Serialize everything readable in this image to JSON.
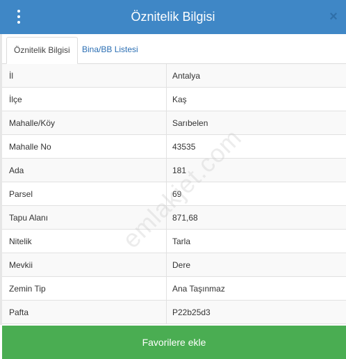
{
  "header": {
    "title": "Öznitelik Bilgisi",
    "menu_icon": "vertical-dots-icon",
    "close_icon": "close-icon",
    "close_glyph": "×"
  },
  "tabs": [
    {
      "label": "Öznitelik Bilgisi",
      "active": true
    },
    {
      "label": "Bina/BB Listesi",
      "active": false
    }
  ],
  "rows": [
    {
      "key": "İl",
      "value": "Antalya"
    },
    {
      "key": "İlçe",
      "value": "Kaş"
    },
    {
      "key": "Mahalle/Köy",
      "value": "Sarıbelen"
    },
    {
      "key": "Mahalle No",
      "value": "43535"
    },
    {
      "key": "Ada",
      "value": "181"
    },
    {
      "key": "Parsel",
      "value": "69"
    },
    {
      "key": "Tapu Alanı",
      "value": "871,68"
    },
    {
      "key": "Nitelik",
      "value": "Tarla"
    },
    {
      "key": "Mevkii",
      "value": "Dere"
    },
    {
      "key": "Zemin Tip",
      "value": "Ana Taşınmaz"
    },
    {
      "key": "Pafta",
      "value": "P22b25d3"
    }
  ],
  "footer": {
    "favorite_label": "Favorilere ekle"
  },
  "watermark": "emlakjet.com",
  "colors": {
    "header": "#3f87c6",
    "tab_link": "#2a6eb3",
    "button": "#4aad52"
  }
}
